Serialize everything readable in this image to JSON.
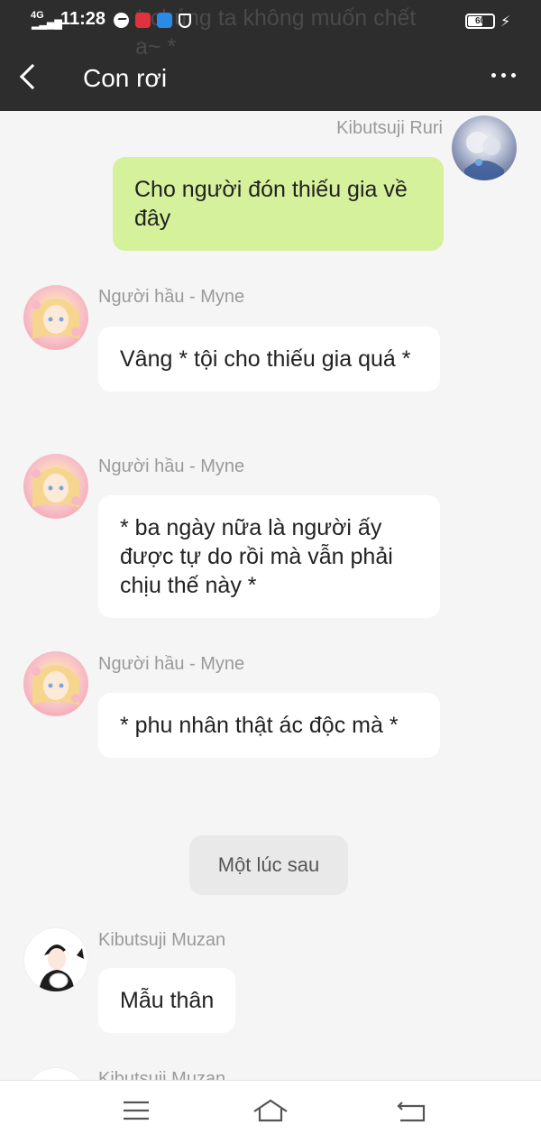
{
  "status_bar": {
    "network": "4G",
    "time": "11:28",
    "battery": "60"
  },
  "header": {
    "title": "Con rơi",
    "ghost_text": "* chúng ta không muốn chết a~ *"
  },
  "messages": [
    {
      "sender": "Kibutsuji Ruri",
      "text": "Cho người đón thiếu gia về đây",
      "side": "right"
    },
    {
      "sender": "Người hầu - Myne",
      "text": "Vâng * tội cho thiếu gia quá *",
      "side": "left"
    },
    {
      "sender": "Người hầu - Myne",
      "text": "* ba ngày nữa là người ấy được tự do rồi mà vẫn phải chịu thế này *",
      "side": "left"
    },
    {
      "sender": "Người hầu - Myne",
      "text": "* phu nhân thật ác độc mà *",
      "side": "left"
    },
    {
      "sender": "Kibutsuji Muzan",
      "text": "Mẫu thân",
      "side": "left"
    },
    {
      "sender": "Kibutsuji Muzan",
      "text": "",
      "side": "left"
    }
  ],
  "time_divider": "Một lúc sau",
  "icons": {
    "back": "back-arrow-icon",
    "more": "more-dots-icon",
    "menu": "menu-icon",
    "home": "home-icon",
    "return": "return-icon"
  },
  "colors": {
    "header_bg": "#2d2d2d",
    "my_bubble": "#d6f19b",
    "other_bubble": "#ffffff",
    "chat_bg": "#f5f5f5"
  }
}
